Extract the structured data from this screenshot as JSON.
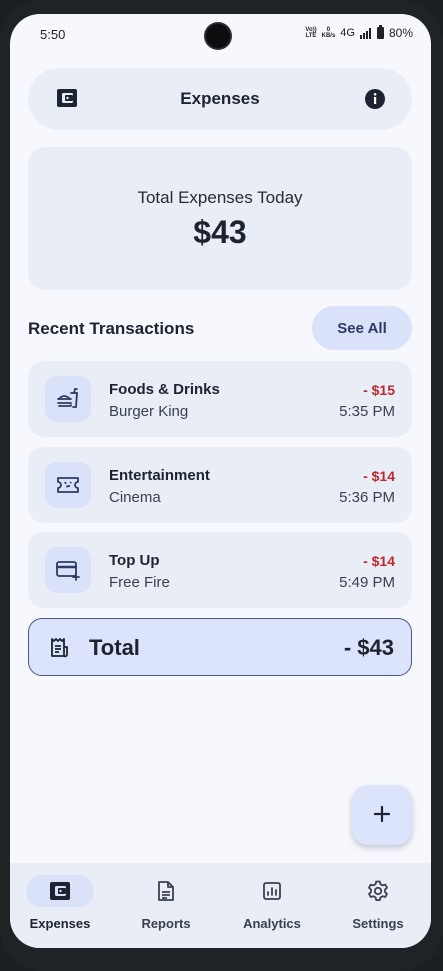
{
  "status_bar": {
    "time": "5:50",
    "volte_top": "Vo))",
    "volte_bottom": "LTE",
    "speed_top": "0",
    "speed_bottom": "KB/s",
    "network": "4G",
    "battery": "80%"
  },
  "header": {
    "title": "Expenses",
    "left_icon": "wallet-icon",
    "right_icon": "info-icon"
  },
  "summary": {
    "label": "Total Expenses Today",
    "amount": "$43"
  },
  "recent": {
    "title": "Recent Transactions",
    "see_all": "See All",
    "transactions": [
      {
        "category": "Foods & Drinks",
        "merchant": "Burger King",
        "amount": "- $15",
        "time": "5:35 PM",
        "icon": "food-icon"
      },
      {
        "category": "Entertainment",
        "merchant": "Cinema",
        "amount": "- $14",
        "time": "5:36 PM",
        "icon": "ticket-icon"
      },
      {
        "category": "Top Up",
        "merchant": "Free Fire",
        "amount": "- $14",
        "time": "5:49 PM",
        "icon": "card-add-icon"
      }
    ]
  },
  "total": {
    "label": "Total",
    "value": "- $43",
    "icon": "receipt-icon"
  },
  "fab": {
    "label": "+"
  },
  "nav": [
    {
      "label": "Expenses",
      "icon": "wallet-icon",
      "active": true
    },
    {
      "label": "Reports",
      "icon": "document-icon",
      "active": false
    },
    {
      "label": "Analytics",
      "icon": "chart-icon",
      "active": false
    },
    {
      "label": "Settings",
      "icon": "gear-icon",
      "active": false
    }
  ],
  "colors": {
    "background": "#f7f8fd",
    "card": "#e9edf6",
    "accent": "#d9e2f8",
    "negative": "#c0272d",
    "text": "#1d2330"
  }
}
